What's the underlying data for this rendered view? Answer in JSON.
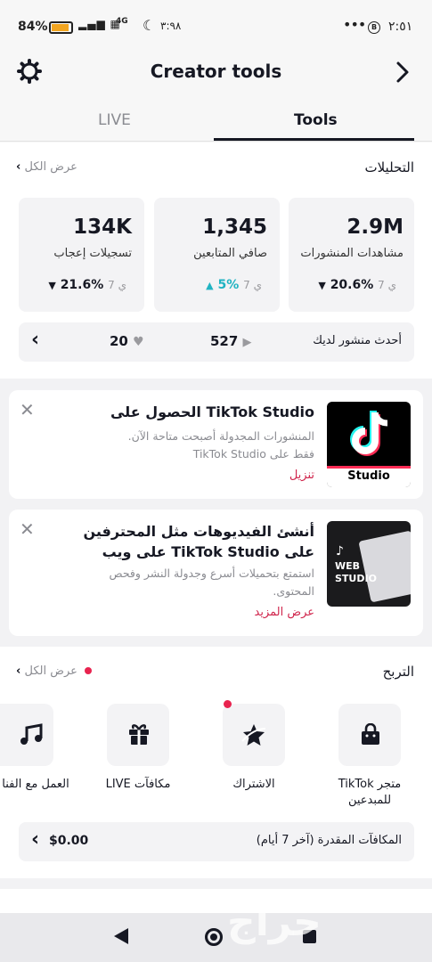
{
  "status_bar": {
    "battery": "84%",
    "network": "4G",
    "time_small": "٣:٩٨",
    "clock": "٢:٥١"
  },
  "header": {
    "title": "Creator tools",
    "tabs": [
      {
        "label": "LIVE"
      },
      {
        "label": "Tools"
      }
    ],
    "active_tab": "Tools"
  },
  "analytics": {
    "title": "التحليلات",
    "view_all": "عرض الكل",
    "stats": [
      {
        "value": "2.9M",
        "label": "مشاهدات المنشورات",
        "change": "20.6%",
        "direction": "down",
        "period": "7 ي"
      },
      {
        "value": "1,345",
        "label": "صافي المتابعين",
        "change": "5%",
        "direction": "up",
        "period": "7 ي"
      },
      {
        "value": "134K",
        "label": "تسجيلات إعجاب",
        "change": "21.6%",
        "direction": "down",
        "period": "7 ي"
      }
    ],
    "latest_post": {
      "label": "أحدث منشور لديك",
      "views": "527",
      "likes": "20"
    }
  },
  "promos": [
    {
      "title_ar": "الحصول على",
      "title_en": "TikTok Studio",
      "subtitle": "المنشورات المجدولة أصبحت متاحة الآن. فقط على TikTok Studio",
      "link": "تنزيل",
      "thumb_text": "Studio"
    },
    {
      "title": "أنشئ الفيديوهات مثل المحترفين على TikTok Studio على ويب",
      "subtitle": "استمتع بتحميلات أسرع وجدولة النشر وفحص المحتوى.",
      "link": "عرض المزيد",
      "thumb_text_1": "WEB",
      "thumb_text_2": "STUDIO"
    }
  ],
  "monetization": {
    "title": "التربح",
    "view_all": "عرض الكل",
    "tools": [
      {
        "label": "متجر TikTok للمبدعين",
        "icon": "shopping-bag-icon"
      },
      {
        "label": "الاشتراك",
        "icon": "subscription-star-icon"
      },
      {
        "label": "مكافآت LIVE",
        "icon": "gift-icon"
      },
      {
        "label": "العمل مع الفنا",
        "icon": "music-note-icon"
      }
    ],
    "earnings_label": "المكافآت المقدرة (آخر 7 أيام)",
    "earnings_value": "$0.00"
  },
  "watermark": "حراج",
  "colors": {
    "accent_red": "#d0254c",
    "teal": "#20b3c2",
    "notification": "#e8234f"
  }
}
